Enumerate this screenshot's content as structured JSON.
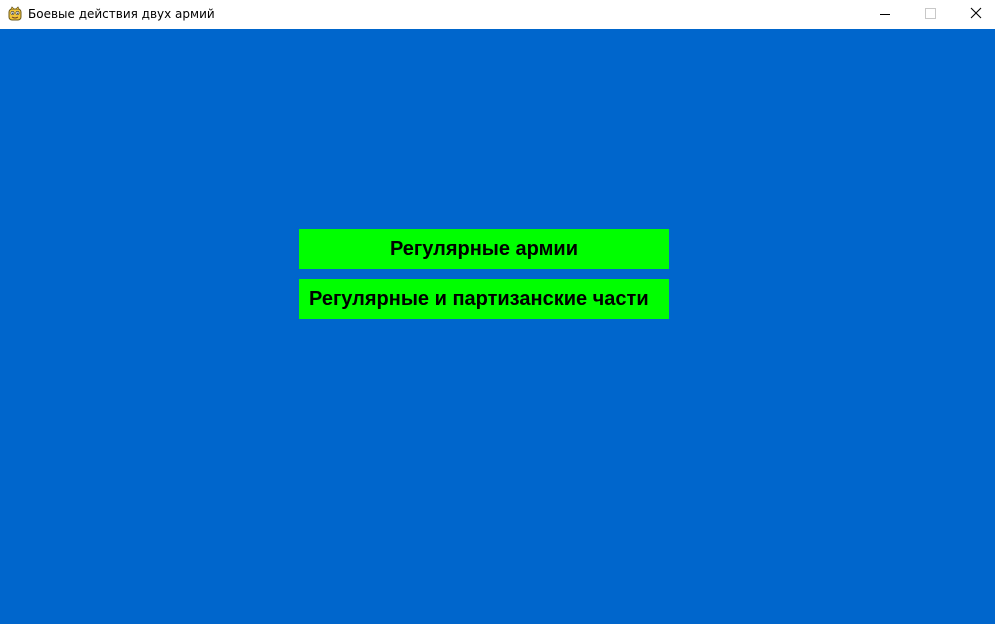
{
  "window": {
    "title": "Боевые действия двух армий",
    "app_icon": "pygame-snake-icon",
    "controls": {
      "minimize_icon": "minimize-icon",
      "maximize_icon": "maximize-icon",
      "close_icon": "close-icon"
    }
  },
  "menu": {
    "background_color": "#0066cc",
    "button_color": "#00ff00",
    "text_color": "#000000",
    "buttons": [
      {
        "label": "Регулярные армии"
      },
      {
        "label": "Регулярные и партизанские части"
      }
    ]
  }
}
